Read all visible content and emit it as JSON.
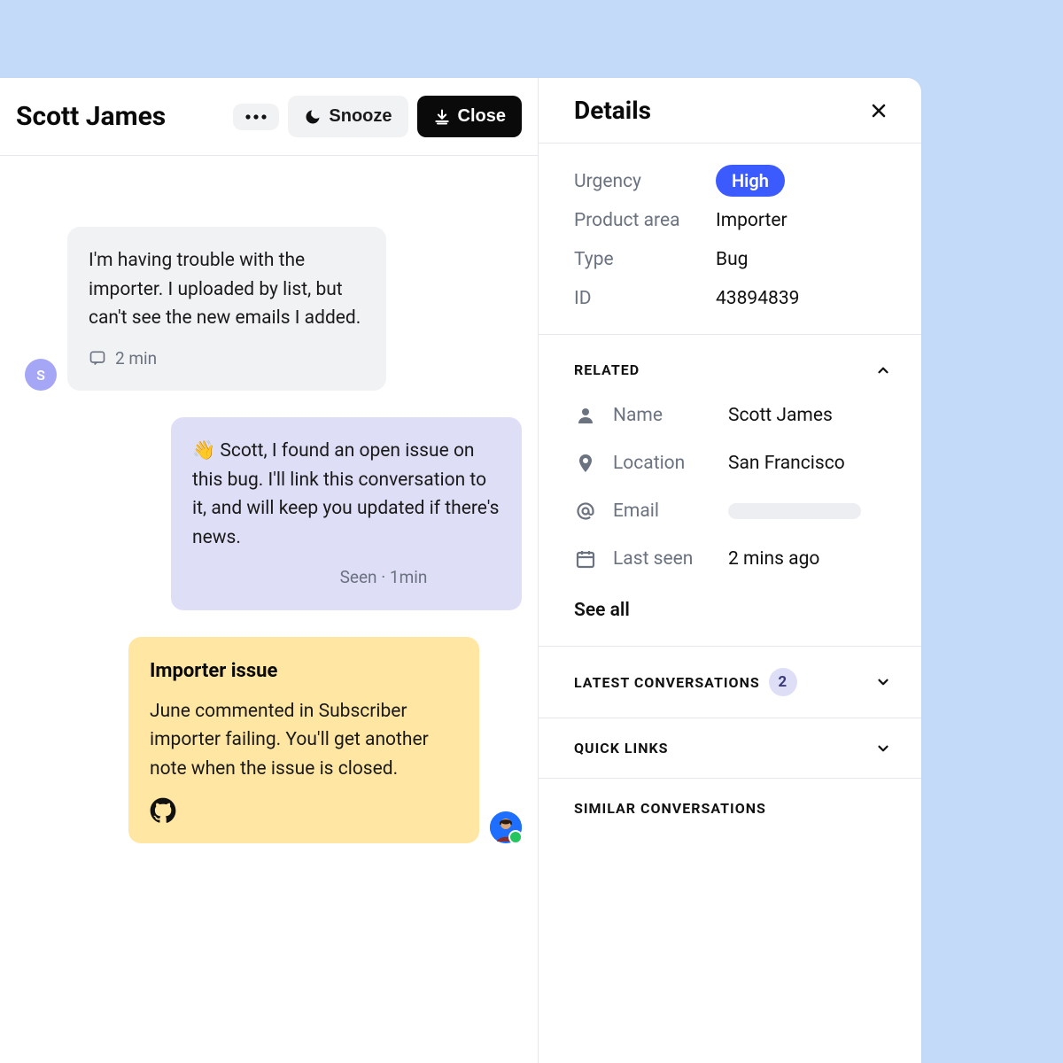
{
  "header": {
    "customer_name": "Scott James",
    "snooze_label": "Snooze",
    "close_label": "Close"
  },
  "messages": {
    "customer": {
      "avatar_letter": "S",
      "text": "I'm having trouble with the importer. I uploaded by list, but can't see the new emails I added.",
      "time": "2 min"
    },
    "agent_reply": {
      "text": "👋 Scott, I found an open issue on this bug. I'll link this conversation to it, and will keep you updated if there's news.",
      "status": "Seen · 1min"
    },
    "note": {
      "title": "Importer issue",
      "text": "June commented in Subscriber importer failing. You'll get another note when the issue is closed."
    }
  },
  "details": {
    "title": "Details",
    "urgency_label": "Urgency",
    "urgency_value": "High",
    "product_area_label": "Product area",
    "product_area_value": "Importer",
    "type_label": "Type",
    "type_value": "Bug",
    "id_label": "ID",
    "id_value": "43894839"
  },
  "related": {
    "heading": "Related",
    "name_label": "Name",
    "name_value": "Scott James",
    "location_label": "Location",
    "location_value": "San Francisco",
    "email_label": "Email",
    "lastseen_label": "Last seen",
    "lastseen_value": "2 mins ago",
    "see_all": "See all"
  },
  "sections": {
    "latest_conversations": "Latest conversations",
    "latest_count": "2",
    "quick_links": "Quick links",
    "similar_conversations": "Similar conversations"
  }
}
